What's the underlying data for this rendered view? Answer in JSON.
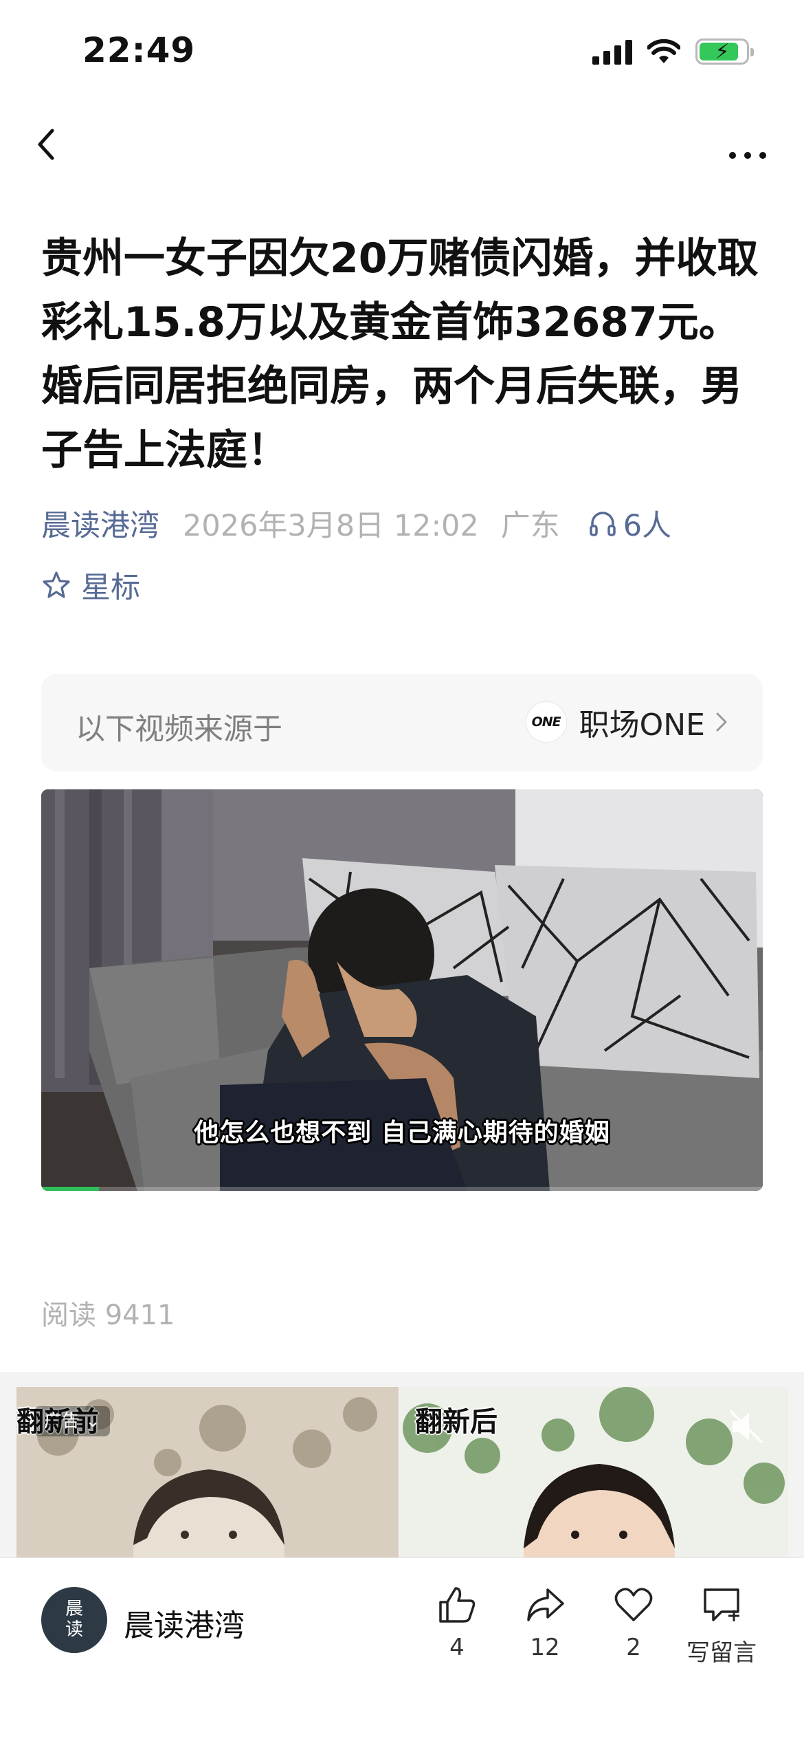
{
  "status_bar": {
    "time": "22:49",
    "battery_level": 0.85
  },
  "article": {
    "title": "贵州一女子因欠20万赌债闪婚，并收取彩礼15.8万以及黄金首饰32687元。婚后同居拒绝同房，两个月后失联，男子告上法庭！",
    "author": "晨读港湾",
    "date": "2026年3月8日 12:02",
    "region": "广东",
    "listeners": "6人",
    "star_label": "星标"
  },
  "video_source": {
    "label": "以下视频来源于",
    "logo_text": "ONE",
    "channel": "职场ONE"
  },
  "video": {
    "subtitle": "他怎么也想不到  自己满心期待的婚姻",
    "progress": 0.08
  },
  "read": {
    "text": "阅读 9411"
  },
  "ad": {
    "before_label": "翻新前",
    "after_label": "翻新后",
    "badge": "广告 ⌄"
  },
  "bottom_bar": {
    "avatar_text_1": "晨",
    "avatar_text_2": "读",
    "account_name": "晨读港湾",
    "like_count": "4",
    "share_count": "12",
    "fav_count": "2",
    "comment_label": "写留言"
  },
  "colors": {
    "link": "#576b95",
    "muted": "#b2b2b2",
    "battery_green": "#34c759",
    "progress_green": "#2fbf5a"
  },
  "icons": [
    "back-chevron-icon",
    "more-dots-icon",
    "signal-icon",
    "wifi-icon",
    "battery-icon",
    "headphones-icon",
    "star-outline-icon",
    "chevron-right-icon",
    "mute-icon",
    "thumbs-up-icon",
    "share-icon",
    "heart-icon",
    "comment-icon"
  ]
}
